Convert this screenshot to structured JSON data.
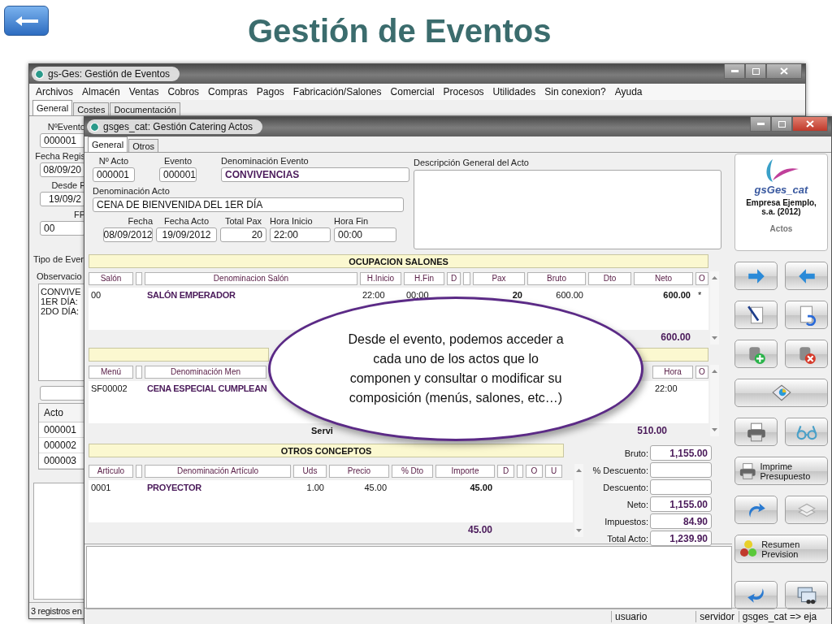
{
  "slide": {
    "title": "Gestión de Eventos"
  },
  "main_window": {
    "title": "gs-Ges: Gestión de Eventos",
    "menu": [
      "Archivos",
      "Almacén",
      "Ventas",
      "Cobros",
      "Compras",
      "Pagos",
      "Fabricación/Salones",
      "Comercial",
      "Procesos",
      "Utilidades",
      "Sin conexion?",
      "Ayuda"
    ],
    "tabs": [
      {
        "label": "General",
        "selected": true
      },
      {
        "label": "Costes",
        "selected": false
      },
      {
        "label": "Documentación",
        "selected": false
      }
    ],
    "fields": [
      {
        "label": "NºEvento",
        "value": "000001"
      },
      {
        "label": "Fecha Regis",
        "value": "08/09/20"
      },
      {
        "label": "Desde F",
        "value": "19/09/2"
      },
      {
        "label": "FP",
        "value": "00"
      }
    ],
    "type_label": "Tipo de Ever",
    "notes": {
      "label": "Observacio",
      "lines": [
        "CONVIVE",
        "1ER DÍA:",
        "2DO DÍA:"
      ]
    },
    "acts": {
      "column": "Acto",
      "rows": [
        "000001",
        "000002",
        "000003"
      ]
    },
    "status": "3 registros en"
  },
  "acts_window": {
    "title": "gsges_cat: Gestión Catering Actos",
    "tabs": [
      {
        "label": "General",
        "selected": true
      },
      {
        "label": "Otros",
        "selected": false
      }
    ],
    "fields": [
      {
        "label": "Nº Acto",
        "value": "000001"
      },
      {
        "label": "Evento",
        "value": "000001"
      },
      {
        "label": "Denominación Evento",
        "value": "CONVIVENCIAS"
      },
      {
        "label": "Denominación Acto",
        "value": "CENA DE BIENVENIDA DEL 1ER DÍA"
      },
      {
        "label": "Fecha",
        "value": "08/09/2012"
      },
      {
        "label": "Fecha Acto",
        "value": "19/09/2012"
      },
      {
        "label": "Total Pax",
        "value": "20"
      },
      {
        "label": "Hora Inicio",
        "value": "22:00"
      },
      {
        "label": "Hora Fin",
        "value": "00:00"
      }
    ],
    "description_label": "Descripción General del Acto",
    "salons": {
      "title": "OCUPACION SALONES",
      "columns": [
        "Salón",
        "Denominacion Salón",
        "H.Inicio",
        "H.Fin",
        "D",
        "Pax",
        "Bruto",
        "Dto",
        "Neto",
        "O"
      ],
      "rows": [
        {
          "salon": "00",
          "name": "SALÓN EMPERADOR",
          "start": "22:00",
          "end": "00:00",
          "pax": "20",
          "gross": "600.00",
          "net": "600.00",
          "o": "*"
        }
      ],
      "total": {
        "net": "600.00"
      }
    },
    "menus": {
      "columns": [
        "Menú",
        "Denominación Men",
        "Hora",
        "O"
      ],
      "rows": [
        {
          "menu": "SF00002",
          "name": "CENA ESPECIAL CUMPLEAN",
          "time": "22:00"
        }
      ],
      "services_label": "Servi",
      "total": "510.00"
    },
    "others": {
      "title": "OTROS CONCEPTOS",
      "columns": [
        "Articulo",
        "Denominación Artículo",
        "Uds",
        "Precio",
        "% Dto",
        "Importe",
        "D",
        "O",
        "U"
      ],
      "rows": [
        {
          "code": "0001",
          "name": "PROYECTOR",
          "qty": "1.00",
          "price": "45.00",
          "amount": "45.00"
        }
      ],
      "total": {
        "amount": "45.00"
      }
    },
    "totals": [
      {
        "label": "Bruto:",
        "value": "1,155.00"
      },
      {
        "label": "% Descuento:"
      },
      {
        "label": "Descuento:"
      },
      {
        "label": "Neto:",
        "value": "1,155.00"
      },
      {
        "label": "Impuestos:",
        "value": "84.90"
      },
      {
        "label": "Total Acto:",
        "value": "1,239.90"
      }
    ],
    "company": {
      "product": "gsGes_cat",
      "name": "Empresa Ejemplo, s.a. (2012)",
      "section": "Actos"
    },
    "labeled_buttons": [
      "Imprime Presupuesto",
      "Resumen Prevision"
    ],
    "status": [
      "usuario",
      "servidor",
      "gsges_cat => eja"
    ]
  },
  "callout": {
    "text": "Desde el evento, podemos acceder a cada uno de los actos que lo componen y consultar o modificar su composición (menús, salones, etc…)"
  }
}
